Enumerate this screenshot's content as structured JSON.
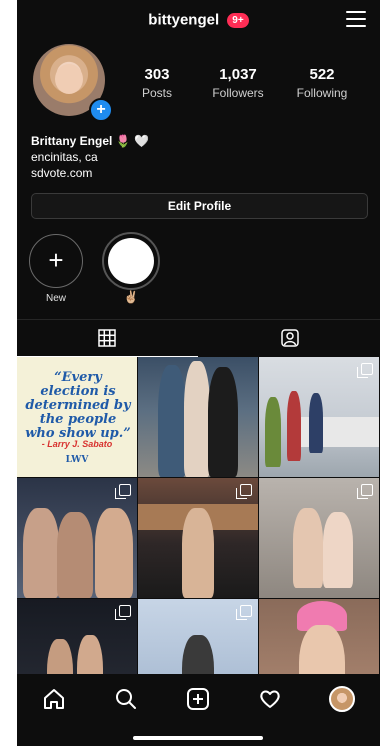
{
  "header": {
    "username": "bittyengel",
    "notification_badge": "9+"
  },
  "profile": {
    "stats": [
      {
        "value": "303",
        "label": "Posts"
      },
      {
        "value": "1,037",
        "label": "Followers"
      },
      {
        "value": "522",
        "label": "Following"
      }
    ],
    "name": "Brittany Engel 🌷 🤍",
    "location": "encinitas, ca",
    "website": "sdvote.com",
    "edit_button": "Edit Profile"
  },
  "highlights": {
    "new_label": "New",
    "highlight_label": "✌🏼"
  },
  "posts": {
    "quote_text": "“Every election is determined by the people who show up.”",
    "quote_author": "- Larry J. Sabato",
    "quote_logo": "LWV"
  },
  "colors": {
    "background": "#0d0d0d",
    "badge": "#ff2d55",
    "avatar_plus": "#1f8cf0",
    "quote_blue": "#1f5aa8",
    "quote_red": "#d8322f"
  },
  "icons": {
    "menu": "hamburger-menu-icon",
    "grid": "grid-icon",
    "tagged": "tagged-person-icon",
    "multi": "carousel-icon",
    "home": "home-icon",
    "search": "search-icon",
    "add": "add-post-icon",
    "activity": "heart-icon",
    "profile": "profile-avatar-icon"
  }
}
